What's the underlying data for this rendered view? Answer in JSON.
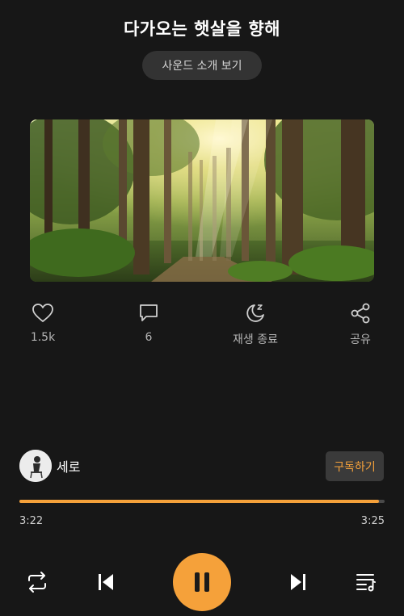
{
  "header": {
    "title": "다가오는 햇살을 향해",
    "intro_button": "사운드 소개 보기"
  },
  "artwork": {
    "description_icon": "forest-sunlight-image"
  },
  "actions": [
    {
      "icon": "heart-icon",
      "label": "1.5k"
    },
    {
      "icon": "comment-icon",
      "label": "6"
    },
    {
      "icon": "sleep-timer-icon",
      "label": "재생 종료"
    },
    {
      "icon": "share-icon",
      "label": "공유"
    }
  ],
  "artist": {
    "name": "세로",
    "subscribe_label": "구독하기"
  },
  "player": {
    "current_time": "3:22",
    "total_time": "3:25",
    "progress": 0.985
  },
  "colors": {
    "accent": "#f5a13a",
    "background": "#171717"
  }
}
